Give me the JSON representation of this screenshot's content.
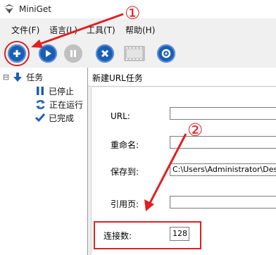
{
  "window": {
    "title": "MiniGet"
  },
  "menu": {
    "items": [
      "文件(F)",
      "语言(L)",
      "工具(T)",
      "帮助(H)"
    ]
  },
  "toolbar": {
    "buttons": [
      {
        "name": "add-task-button",
        "icon": "plus-circle-icon"
      },
      {
        "name": "start-button",
        "icon": "play-circle-icon"
      },
      {
        "name": "pause-button",
        "icon": "pause-circle-icon",
        "disabled": true
      },
      {
        "name": "delete-button",
        "icon": "x-circle-icon"
      },
      {
        "name": "video-button",
        "icon": "film-icon",
        "disabled": true
      },
      {
        "name": "settings-button",
        "icon": "gear-icon"
      }
    ]
  },
  "tree": {
    "collapse_symbol": "⊟",
    "root_label": "任务",
    "children": [
      "已停止",
      "正在运行",
      "已完成"
    ]
  },
  "dialog": {
    "title": "新建URL任务",
    "url_label": "URL:",
    "url_value": "",
    "rename_label": "重命名:",
    "rename_value": "",
    "save_label": "保存到:",
    "save_value": "C:\\Users\\Administrator\\Deskto",
    "referer_label": "引用页:",
    "referer_value": "",
    "connections_label": "连接数:",
    "connections_value": "128"
  },
  "annotations": {
    "first": "①",
    "second": "②",
    "color": "#e02020"
  },
  "colors": {
    "toolbar_blue": "#1a5fb4",
    "disabled_gray": "#c0c0c0"
  }
}
